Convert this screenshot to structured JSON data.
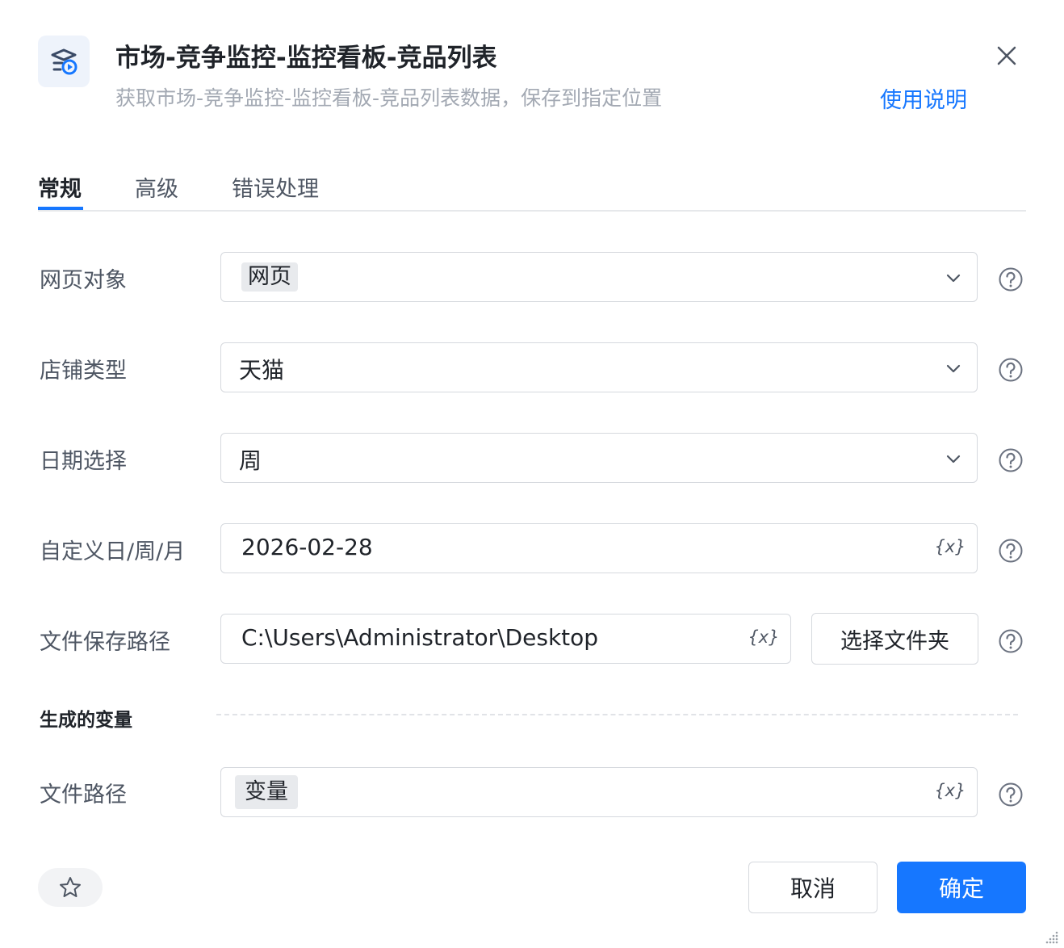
{
  "header": {
    "title": "市场-竞争监控-监控看板-竞品列表",
    "subtitle": "获取市场-竞争监控-监控看板-竞品列表数据，保存到指定位置",
    "help_link": "使用说明",
    "icon": "app-icon",
    "close_icon": "close-icon"
  },
  "tabs": [
    {
      "label": "常规",
      "active": true
    },
    {
      "label": "高级",
      "active": false
    },
    {
      "label": "错误处理",
      "active": false
    }
  ],
  "form": {
    "web_object": {
      "label": "网页对象",
      "value": "网页"
    },
    "shop_type": {
      "label": "店铺类型",
      "value": "天猫"
    },
    "date_select": {
      "label": "日期选择",
      "value": "周"
    },
    "custom_date": {
      "label": "自定义日/周/月",
      "value": "2026-02-28"
    },
    "save_path": {
      "label": "文件保存路径",
      "value": "C:\\Users\\Administrator\\Desktop",
      "button": "选择文件夹"
    }
  },
  "generated": {
    "section_title": "生成的变量",
    "file_path": {
      "label": "文件路径",
      "value": "变量"
    }
  },
  "variable_icon_text": "{x}",
  "footer": {
    "cancel": "取消",
    "confirm": "确定"
  },
  "colors": {
    "accent": "#1677ff",
    "chip_bg": "#e8eaed",
    "muted_text": "#a3a9b3"
  }
}
